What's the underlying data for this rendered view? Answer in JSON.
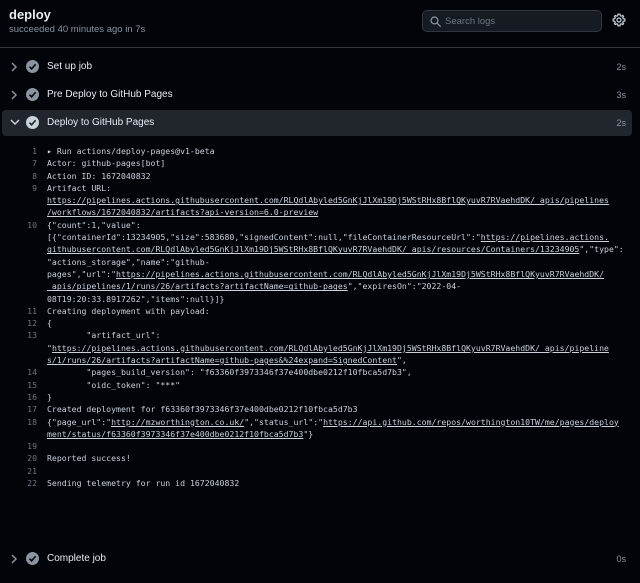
{
  "job": {
    "title": "deploy",
    "subtitle": "succeeded 40 minutes ago in 7s"
  },
  "search": {
    "placeholder": "Search logs"
  },
  "steps": [
    {
      "label": "Set up job",
      "time": "2s"
    },
    {
      "label": "Pre Deploy to GitHub Pages",
      "time": "3s"
    },
    {
      "label": "Deploy to GitHub Pages",
      "time": "2s"
    },
    {
      "label": "Complete job",
      "time": "0s"
    }
  ],
  "log": {
    "n1": "1",
    "l1": "▸ Run actions/deploy-pages@v1-beta",
    "n7": "7",
    "l7": "Actor: github-pages[bot]",
    "n8": "8",
    "l8": "Action ID: 1672040832",
    "n9": "9",
    "l9": "Artifact URL:",
    "l9b": "https://pipelines.actions.githubusercontent.com/RLQdlAbyled5GnKjJlXm19Dj5WStRHx8BflQKyuvR7RVaehdDK/_apis/pipelines",
    "l9c": "/workflows/1672040832/artifacts?api-version=6.0-preview",
    "n10": "10",
    "l10a": "{\"count\":1,\"value\":",
    "l10b1": "[{\"containerId\":13234905,\"size\":583680,\"signedContent\":null,\"fileContainerResourceUrl\":\"",
    "l10b2": "https://pipelines.actions.",
    "l10c1": "githubusercontent.com/RLQdlAbyled5GnKjJlXm19Dj5WStRHx8BflQKyuvR7RVaehdDK/_apis/resources/Containers/13234905",
    "l10c2": "\",\"type\":",
    "l10d": "\"actions_storage\",\"name\":\"github-",
    "l10e1": "pages\",\"url\":\"",
    "l10e2": "https://pipelines.actions.githubusercontent.com/RLQdlAbyled5GnKjJlXm19Dj5WStRHx8BflQKyuvR7RVaehdDK/",
    "l10f1": "_apis/pipelines/1/runs/26/artifacts?artifactName=github-pages",
    "l10f2": "\",\"expiresOn\":\"2022-04-",
    "l10g": "08T19:20:33.8917262\",\"items\":null}]}",
    "n11": "11",
    "l11": "Creating deployment with payload:",
    "n12": "12",
    "l12": "{",
    "n13": "13",
    "l13a": "        \"artifact_url\":",
    "l13b1": "\"",
    "l13b2": "https://pipelines.actions.githubusercontent.com/RLQdlAbyled5GnKjJlXm19Dj5WStRHx8BflQKyuvR7RVaehdDK/_apis/pipeline",
    "l13c1": "s/1/runs/26/artifacts?artifactName=github-pages&%24expand=SignedContent",
    "l13c2": "\",",
    "n14": "14",
    "l14": "        \"pages_build_version\": \"f63360f3973346f37e400dbe0212f10fbca5d7b3\",",
    "n15": "15",
    "l15": "        \"oidc_token\": \"***\"",
    "n16": "16",
    "l16": "}",
    "n17": "17",
    "l17": "Created deployment for f63360f3973346f37e400dbe0212f10fbca5d7b3",
    "n18": "18",
    "l18a1": "{\"page_url\":\"",
    "l18a2": "http://mzworthington.co.uk/",
    "l18a3": "\",\"status_url\":\"",
    "l18a4": "https://api.github.com/repos/worthington10TW/me/pages/deploy",
    "l18b1": "ment/status/f63360f3973346f37e400dbe0212f10fbca5d7b3",
    "l18b2": "\"}",
    "n19": "19",
    "n20": "20",
    "l20": "Reported success!",
    "n21": "21",
    "n22": "22",
    "l22": "Sending telemetry for run id 1672040832"
  }
}
